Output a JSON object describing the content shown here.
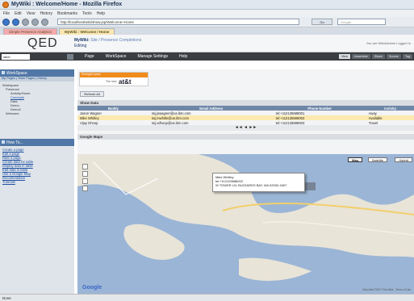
{
  "window": {
    "title": "MyWiki : Welcome/Home - Mozilla Firefox"
  },
  "menu": [
    "File",
    "Edit",
    "View",
    "History",
    "Bookmarks",
    "Tools",
    "Help"
  ],
  "url": "http://localhost/wiki/show.jsp/Welcome+Home",
  "go_label": "Go",
  "search_placeholder": "Google",
  "tabs": [
    {
      "label": "Simple Presence Analytics"
    },
    {
      "label": "MyWiki : Welcome / Home"
    }
  ],
  "header": {
    "logo": "QED",
    "title": "MyWiki:",
    "breadcrumb": "Site / Presence Completions",
    "subtitle": "Editing",
    "right_text": "You are Wiki&Admin Logged In"
  },
  "appbar": {
    "selector": "label",
    "menus": [
      "Page",
      "WorkSpace",
      "Manage Settings",
      "Help"
    ],
    "buttons": [
      "View",
      "Assemble",
      "Share",
      "Source",
      "Tag"
    ]
  },
  "sidebar": {
    "workspace_title": "WorkSpace",
    "tabs": "My Pages | Team Pages | History",
    "tree": [
      "Workspace",
      "Presence",
      "Activity/Home",
      "Concepts",
      "Data",
      "Demo",
      "Demo2",
      "Welcome"
    ],
    "howto_title": "How To...",
    "howto_items": [
      "Create a page",
      "Edit a page",
      "Rate a page",
      "Create data for table",
      "Display data in table",
      "Edit data in table",
      "Use a Google Map",
      "Documentation",
      "Tutorials"
    ]
  },
  "widget": {
    "banner": "Emergent pace",
    "prefix": "The new",
    "brand": "at&t"
  },
  "refresh_label": "Refresh All",
  "show_data": {
    "title": "Show Data",
    "columns": [
      "Buddy",
      "Email Address",
      "Phone Number",
      "Activity"
    ],
    "rows": [
      [
        "Jason Wagner",
        "ssj.jswagner@us.ibm.com",
        "tel:+112125688001",
        "Away"
      ],
      [
        "Mike Whitley",
        "ssj.mwhitle@us.ibm.com",
        "tel:+112125688002",
        "Available"
      ],
      [
        "Vijay Dhoop",
        "ssj.vdhoop@us.ibm.com",
        "tel:+112125688003",
        "Travel"
      ]
    ],
    "pager": "◄◄ ◄ ►►"
  },
  "map": {
    "title": "Google Maps",
    "types": [
      "Map",
      "Satellite",
      "Hybrid"
    ],
    "balloon": [
      "Mike Whitley",
      "tel:+112125688002",
      "W TOWER LN, BUZZARDS BAY, MA 02532-3407"
    ],
    "copyright": "Map data ©2007 Tele Atlas - Terms of Use",
    "google": "Google"
  },
  "status": "Done"
}
